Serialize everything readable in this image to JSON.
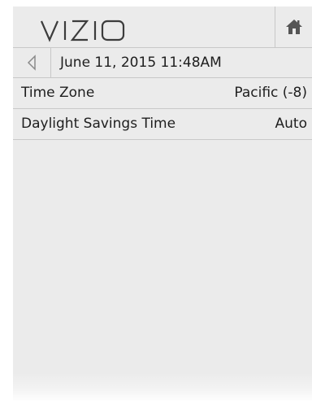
{
  "brand": {
    "logo_text": "VIZIO",
    "logo_color": "#3c3c3c"
  },
  "header": {
    "home_icon": "home-icon"
  },
  "nav": {
    "back_icon": "back-arrow-icon",
    "breadcrumb": "June 11, 2015 11:48AM"
  },
  "menu": {
    "items": [
      {
        "label": "Time Zone",
        "value": "Pacific (-8)"
      },
      {
        "label": "Daylight Savings Time",
        "value": "Auto"
      }
    ]
  },
  "colors": {
    "panel_bg": "#ebebeb",
    "divider": "#c8c8c8",
    "text": "#1e1e1e",
    "icon": "#555555"
  }
}
